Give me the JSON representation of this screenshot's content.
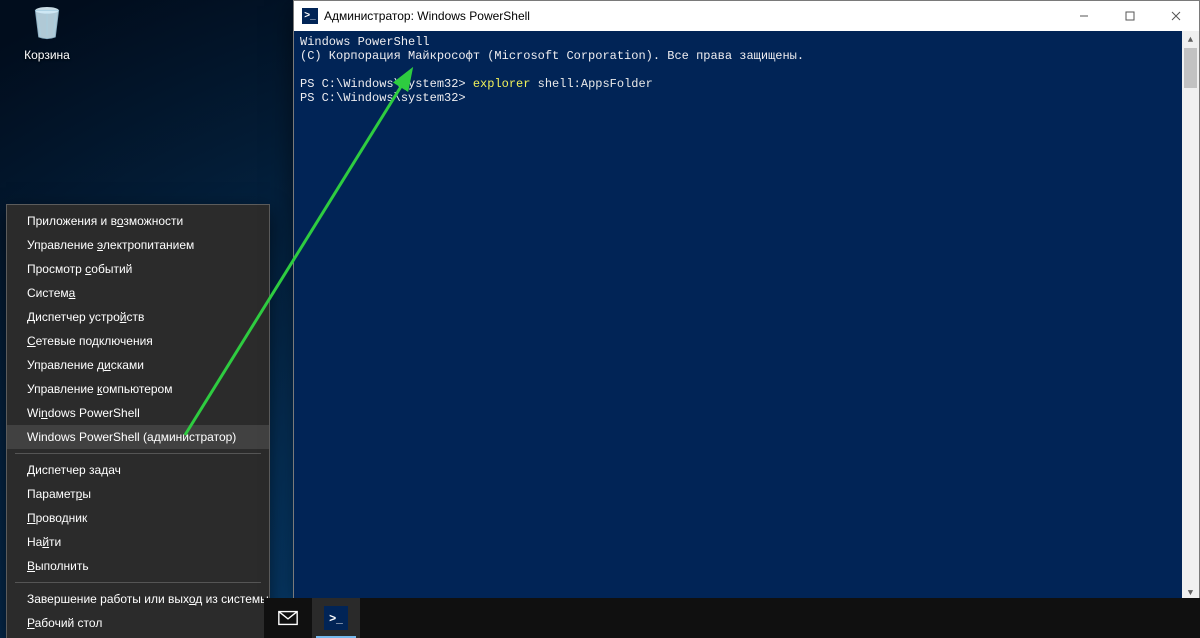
{
  "desktop": {
    "recycle_bin_label": "Корзина"
  },
  "quickmenu": {
    "items": [
      {
        "raw": "Приложения и возможности",
        "mn_idx": 14
      },
      {
        "raw": "Управление электропитанием",
        "mn_idx": 11
      },
      {
        "raw": "Просмотр событий",
        "mn_idx": 9
      },
      {
        "raw": "Система",
        "mn_idx": 6
      },
      {
        "raw": "Диспетчер устройств",
        "mn_idx": 15
      },
      {
        "raw": "Сетевые подключения",
        "mn_idx": 0
      },
      {
        "raw": "Управление дисками",
        "mn_idx": 12
      },
      {
        "raw": "Управление компьютером",
        "mn_idx": 11
      },
      {
        "raw": "Windows PowerShell",
        "mn_idx": 2
      },
      {
        "raw": "Windows PowerShell (администратор)",
        "mn_idx": -1,
        "highlight": true
      },
      {
        "sep": true
      },
      {
        "raw": "Диспетчер задач",
        "mn_idx": 0
      },
      {
        "raw": "Параметры",
        "mn_idx": 7
      },
      {
        "raw": "Проводник",
        "mn_idx": 0
      },
      {
        "raw": "Найти",
        "mn_idx": 2
      },
      {
        "raw": "Выполнить",
        "mn_idx": 0
      },
      {
        "sep": true
      },
      {
        "raw": "Завершение работы или выход из системы",
        "mn_idx": 25
      },
      {
        "raw": "Рабочий стол",
        "mn_idx": 0
      }
    ]
  },
  "ps_window": {
    "title": "Администратор: Windows PowerShell",
    "lines": {
      "l1": "Windows PowerShell",
      "l2": "(C) Корпорация Майкрософт (Microsoft Corporation). Все права защищены.",
      "prompt1": "PS C:\\Windows\\system32>",
      "cmd_name": "explorer",
      "cmd_arg": "shell:AppsFolder",
      "prompt2": "PS C:\\Windows\\system32>"
    }
  }
}
